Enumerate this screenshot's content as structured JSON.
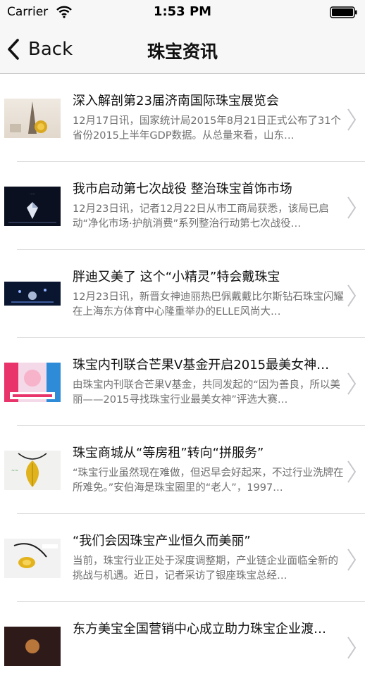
{
  "status": {
    "carrier": "Carrier",
    "time": "1:53 PM"
  },
  "nav": {
    "back_label": "Back",
    "title": "珠宝资讯"
  },
  "items": [
    {
      "title": "深入解剖第23届济南国际珠宝展览会",
      "desc": "12月17日讯，国家统计局2015年8月21日正式公布了31个省份2015上半年GDP数据。从总量来看，山东…"
    },
    {
      "title": "我市启动第七次战役 整治珠宝首饰市场",
      "desc": "12月23日讯，记者12月22日从市工商局获悉，该局已启动“净化市场·护航消费”系列整治行动第七次战役…"
    },
    {
      "title": "胖迪又美了 这个“小精灵”特会戴珠宝",
      "desc": "12月23日讯，新晋女神迪丽热巴佩戴戴比尔斯钻石珠宝闪耀在上海东方体育中心隆重举办的ELLE风尚大…"
    },
    {
      "title": "珠宝内刊联合芒果V基金开启2015最美女神…",
      "desc": "由珠宝内刊联合芒果V基金，共同发起的“因为善良，所以美丽——2015寻找珠宝行业最美女神”评选大赛…"
    },
    {
      "title": "珠宝商城从“等房租”转向“拼服务”",
      "desc": "“珠宝行业虽然现在难做，但迟早会好起来，不过行业洗牌在所难免。”安伯海是珠宝圈里的“老人”，1997…"
    },
    {
      "title": "“我们会因珠宝产业恒久而美丽”",
      "desc": "当前，珠宝行业正处于深度调整期，产业链企业面临全新的挑战与机遇。近日，记者采访了银座珠宝总经…"
    },
    {
      "title": "东方美宝全国营销中心成立助力珠宝企业渡…",
      "desc": ""
    }
  ]
}
